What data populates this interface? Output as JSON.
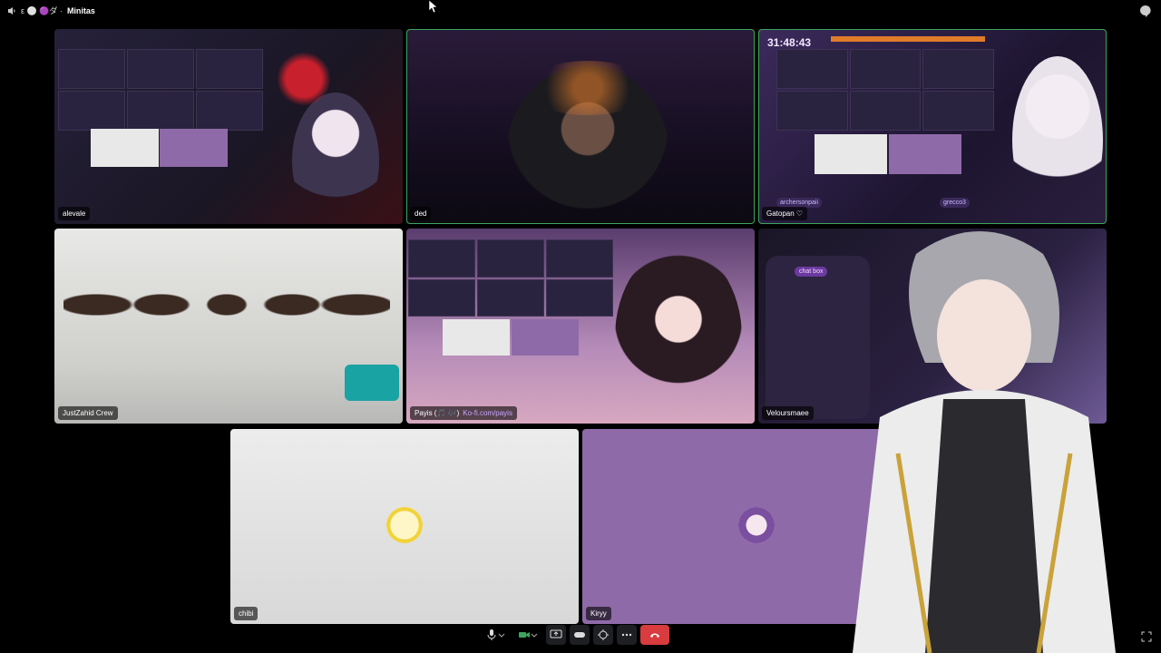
{
  "header": {
    "channel_name": "Minitas",
    "channel_prefix": "ε ⚪ 🟣ダ ·"
  },
  "participants": [
    {
      "name": "alevale"
    },
    {
      "name": "ded"
    },
    {
      "name": "Gatopan ♡",
      "overlay_timer": "31:48:43",
      "overlay_tag1": "archersonpaii",
      "overlay_tag2": "grecco3"
    },
    {
      "name": "JustZahid Crew"
    },
    {
      "name": "Payis (🎵 🎶)",
      "link": "Ko-fi.com/payis"
    },
    {
      "name": "Veloursmaee",
      "overlay_label": "chat box"
    },
    {
      "name": "chibi"
    },
    {
      "name": "Kiryy"
    }
  ],
  "controls": {
    "mic": "microphone-icon",
    "camera": "camera-icon",
    "share": "screen-share-icon",
    "activity": "gamepad-icon",
    "soundboard": "soundboard-icon",
    "more": "more-icon",
    "disconnect": "hang-up-icon"
  },
  "colors": {
    "active_border": "#3ba55d",
    "chibi_bg": "#e6e6e6",
    "kiryy_bg": "#8f6aa8",
    "end_call": "#d83c3e"
  }
}
